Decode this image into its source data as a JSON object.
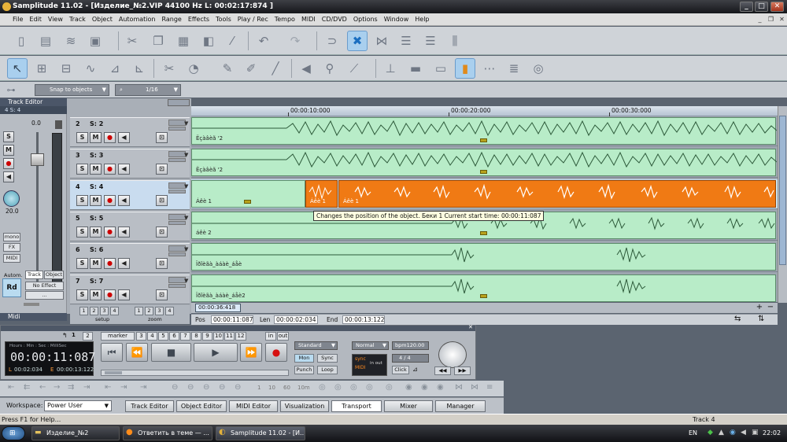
{
  "window": {
    "title": "Samplitude 11.02 - [Изделие_№2.VIP   44100 Hz L: 00:02:17:874 ]",
    "controls": [
      "_",
      "□",
      "✕"
    ]
  },
  "menu": [
    "File",
    "Edit",
    "View",
    "Track",
    "Object",
    "Automation",
    "Range",
    "Effects",
    "Tools",
    "Play / Rec",
    "Tempo",
    "MIDI",
    "CD/DVD",
    "Options",
    "Window",
    "Help"
  ],
  "snap": {
    "label": "Snap to objects",
    "grid": "1/16"
  },
  "track_editor": {
    "title": "Track Editor",
    "current_track": "4   S: 4",
    "volume": "0.0",
    "pan": "20.0",
    "buttons": {
      "s": "S",
      "m": "M",
      "rd": "Rd",
      "mono": "mono",
      "fx": "FX",
      "midi": "MIDI",
      "autom": "Autom.",
      "track": "Track",
      "object": "Object",
      "no_effect": "No Effect",
      "dots": "...",
      "midi_section": "Midi"
    }
  },
  "tracks": [
    {
      "num": "2",
      "name": "S: 2",
      "object_label": "Ёçàâèã '2"
    },
    {
      "num": "3",
      "name": "S: 3",
      "object_label": "Ёçàâèã '2"
    },
    {
      "num": "4",
      "name": "S: 4",
      "object_label": "Áêè 1",
      "orange_labels": [
        "Áêè 1",
        "Áêè 1"
      ]
    },
    {
      "num": "5",
      "name": "S: 5",
      "object_label": "áêè 2"
    },
    {
      "num": "6",
      "name": "S: 6",
      "object_label": "Ïðîèãà_àáàè_áåè"
    },
    {
      "num": "7",
      "name": "S: 7",
      "object_label": "Ïðîèãà_àáàè_áåè2"
    }
  ],
  "track_buttons": {
    "s": "S",
    "m": "M"
  },
  "ruler": {
    "labels": [
      "00:00:10:000",
      "00:00:20:000",
      "00:00:30:000"
    ],
    "marker_text": "00:00:36:418"
  },
  "tooltip": "Changes the position of the object. Беки 1 Current start time: 00:00:11:087",
  "setup_zoom": {
    "setup": "setup",
    "zoom": "zoom",
    "nums": [
      "1",
      "2",
      "3",
      "4"
    ]
  },
  "position": {
    "pos_label": "Pos",
    "pos": "00:00:11:087",
    "len_label": "Len",
    "len": "00:00:02:034",
    "end_label": "End",
    "end": "00:00:13:122"
  },
  "transport": {
    "lcd_header": "Hours : Min : Sec : MilliSec",
    "lcd_time": "00:00:11:087",
    "lcd_l": "L",
    "lcd_l_time": "00:02:034",
    "lcd_e": "E",
    "lcd_e_time": "00:00:13:122",
    "number_buttons": [
      "1",
      "2",
      "3",
      "4",
      "5",
      "6",
      "7",
      "8",
      "9",
      "10",
      "11",
      "12"
    ],
    "marker": "marker",
    "in": "in",
    "out": "out",
    "mode": "Standard",
    "mon": "Mon",
    "sync": "Sync",
    "punch": "Punch",
    "loop": "Loop",
    "normal": "Normal",
    "bpm": "bpm120.00",
    "sig": "4 / 4",
    "click": "Click",
    "sync_indicator": "sync",
    "midi_indicator": "MIDI",
    "in_out": "in out"
  },
  "bottom_toolbar_labels": [
    "1",
    "10",
    "60",
    "10m"
  ],
  "workspace": {
    "label": "Workspace:",
    "value": "Power User",
    "buttons": [
      "Track Editor",
      "Object Editor",
      "MIDI Editor",
      "Visualization",
      "Transport",
      "Mixer",
      "Manager"
    ]
  },
  "status": {
    "left": "Press F1 for Help...",
    "right": "Track 4"
  },
  "taskbar": {
    "tasks": [
      "Изделие_№2",
      "Ответить в теме — ...",
      "Samplitude 11.02 - [И..."
    ],
    "lang": "EN",
    "clock": "22:02"
  }
}
